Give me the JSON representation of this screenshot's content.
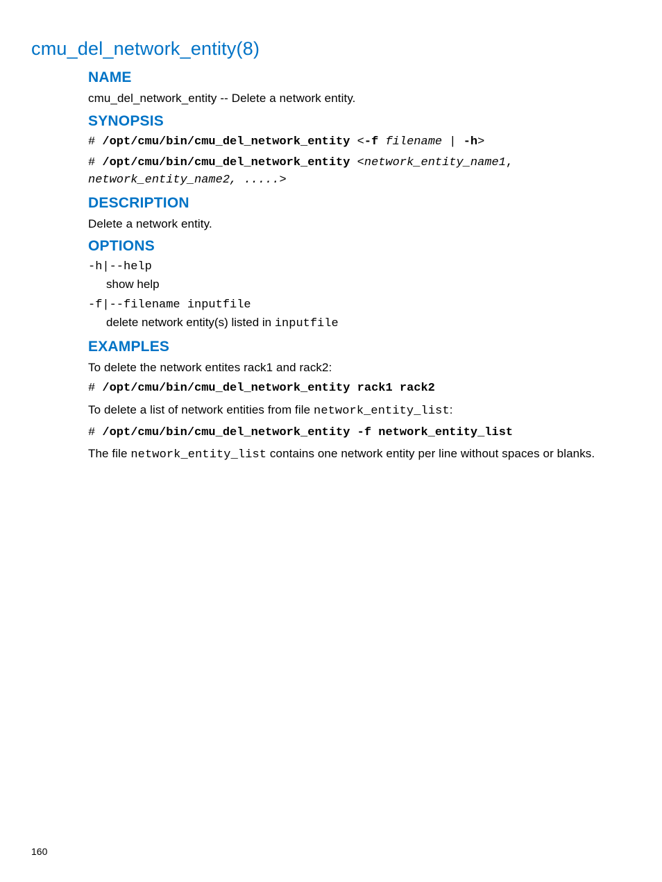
{
  "title": "cmu_del_network_entity(8)",
  "page_number": "160",
  "sections": {
    "name": {
      "heading": "NAME",
      "text": "cmu_del_network_entity -- Delete a network entity."
    },
    "synopsis": {
      "heading": "SYNOPSIS",
      "line1": {
        "prompt": "# ",
        "cmd": "/opt/cmu/bin/cmu_del_network_entity",
        "open": " <",
        "flag1": "-f",
        "sp": " ",
        "arg1": "filename",
        "pipe": " | ",
        "flag2": "-h",
        "close": ">"
      },
      "line2": {
        "prompt": "# ",
        "cmd": "/opt/cmu/bin/cmu_del_network_entity",
        "open": " <",
        "arg1": "network_entity_name1",
        "sep": ", ",
        "arg2": "network_entity_name2",
        "dots": ", .....",
        "close": ">"
      }
    },
    "description": {
      "heading": "DESCRIPTION",
      "text": "Delete a network entity."
    },
    "options": {
      "heading": "OPTIONS",
      "opt1": {
        "term": "-h|--help",
        "desc": "show help"
      },
      "opt2": {
        "term": "-f|--filename inputfile",
        "desc_pre": "delete network entity(s) listed in ",
        "desc_code": "inputfile"
      }
    },
    "examples": {
      "heading": "EXAMPLES",
      "intro1": "To delete the network entites rack1 and rack2:",
      "cmd1_prompt": "# ",
      "cmd1": "/opt/cmu/bin/cmu_del_network_entity rack1 rack2",
      "intro2_pre": "To delete a list of network entities from file ",
      "intro2_code": "network_entity_list",
      "intro2_post": ":",
      "cmd2_prompt": "# ",
      "cmd2": "/opt/cmu/bin/cmu_del_network_entity -f network_entity_list",
      "note_pre": "The file ",
      "note_code": "network_entity_list",
      "note_post": " contains one network entity per line without spaces or blanks."
    }
  }
}
